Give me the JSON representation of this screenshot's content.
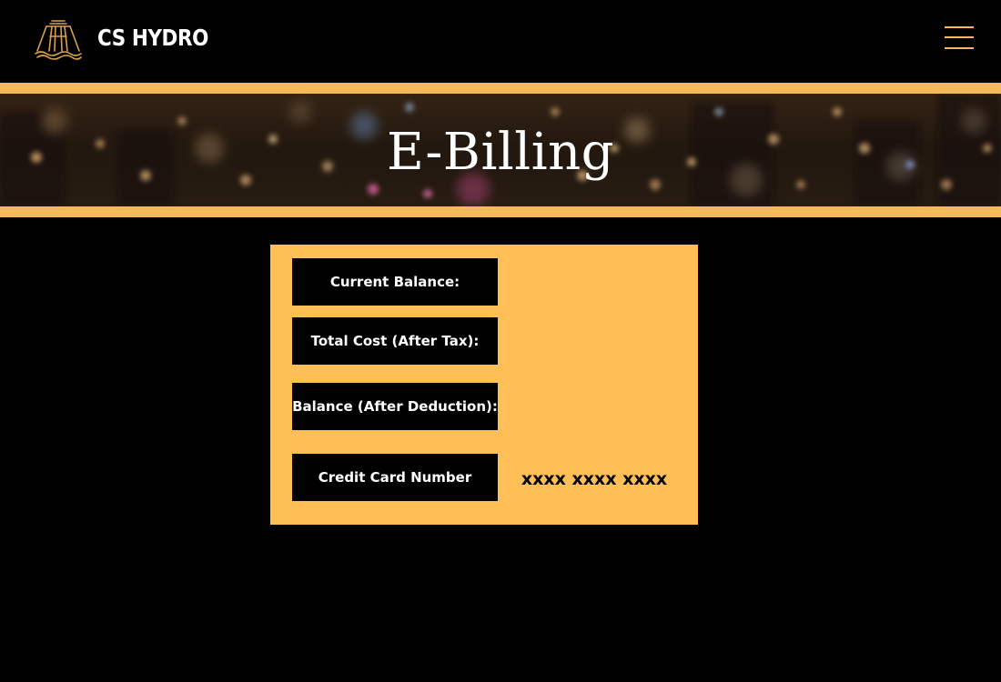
{
  "header": {
    "brand_name": "CS HYDRO",
    "logo_icon": "dam-logo-icon",
    "menu_icon": "hamburger-menu-icon"
  },
  "hero": {
    "title": "E-Billing"
  },
  "billing": {
    "current_balance_label": "Current Balance:",
    "current_balance_value": "",
    "total_cost_label": "Total Cost (After Tax):",
    "total_cost_value": "",
    "balance_after_label": "Balance (After Deduction):",
    "balance_after_value": "",
    "card_number_label": "Credit Card Number",
    "card_number_value": "xxxx xxxx xxxx"
  },
  "colors": {
    "background": "#000000",
    "accent": "#f6b95a",
    "card": "#fec056",
    "label_background": "#000000",
    "label_text": "#ffffff"
  }
}
